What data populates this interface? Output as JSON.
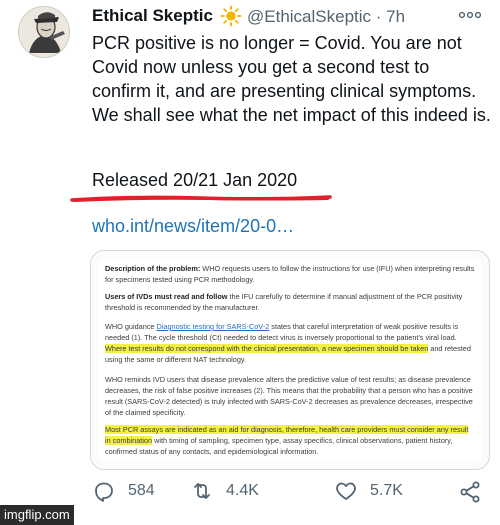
{
  "tweet": {
    "author_name": "Ethical Skeptic",
    "author_emoji_icon": "sun-icon",
    "handle": "@EthicalSkeptic",
    "separator": "·",
    "time": "7h",
    "text": "PCR positive is no longer = Covid. You are not Covid now unless you get a second test to confirm it, and are presenting clinical symptoms. We shall see what the net impact of this indeed is.",
    "released": "Released 20/21 Jan 2020",
    "link": "who.int/news/item/20-0…",
    "underline_color": "#e0202a",
    "link_color": "#1d75b8"
  },
  "document": {
    "p1_label": "Description of the problem:",
    "p1_text": " WHO requests users to follow the instructions for use (IFU) when interpreting results for specimens tested using PCR methodology.",
    "p2_label": "Users of IVDs must read and follow",
    "p2_text": " the IFU carefully to determine if manual adjustment of the PCR positivity threshold is recommended by the manufacturer.",
    "p3_pre": "WHO guidance ",
    "p3_link": "Diagnostic testing for SARS-CoV-2",
    "p3_mid": " states that careful interpretation of weak positive results is needed (1). The cycle threshold (Ct) needed to detect virus is inversely proportional to the patient's viral load. ",
    "p3_highlight": "Where test results do not correspond with the clinical presentation, a new specimen should be taken",
    "p3_post": " and retested using the same or different NAT technology.",
    "p4_text": "WHO reminds IVD users that disease prevalence alters the predictive value of test results; as disease prevalence decreases, the risk of false positive increases (2). This means that the probability that a person who has a positive result (SARS-CoV-2 detected) is truly infected with SARS-CoV-2 decreases as prevalence decreases, irrespective of the claimed specificity.",
    "p5_highlight": "Most PCR assays are indicated as an aid for diagnosis, therefore, health care providers must consider any result in combination",
    "p5_text": " with timing of sampling, specimen type, assay specifics, clinical observations, patient history, confirmed status of any contacts, and epidemiological information.",
    "highlight_color": "#f3f243"
  },
  "actions": {
    "reply_count": "584",
    "retweet_count": "4.4K",
    "like_count": "5.7K"
  },
  "watermark": "imgflip.com"
}
